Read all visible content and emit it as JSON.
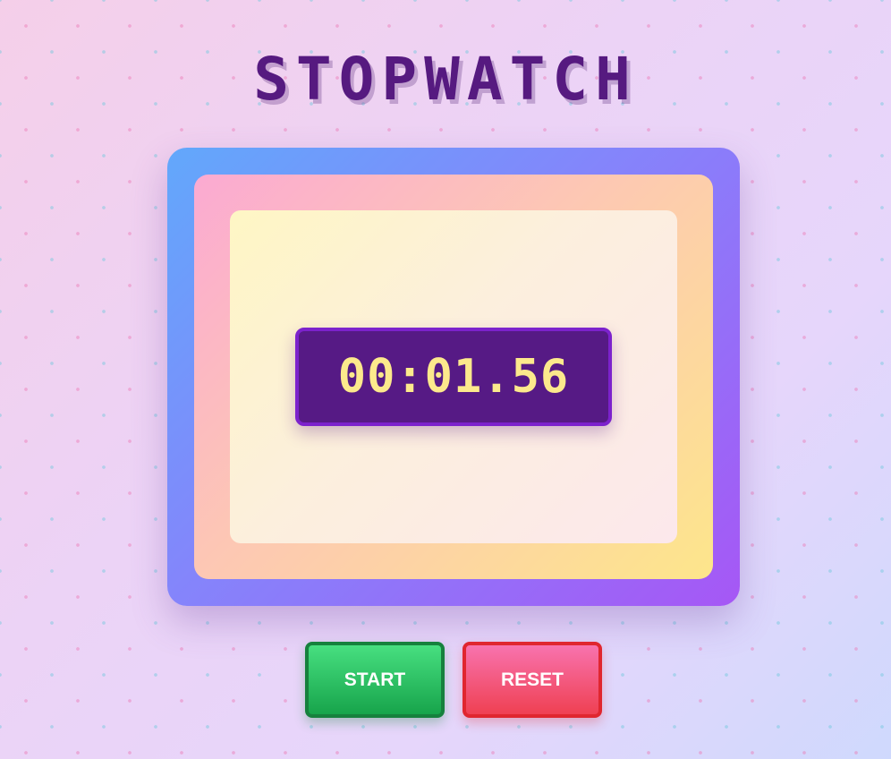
{
  "app": {
    "title": "STOPWATCH"
  },
  "display": {
    "time": "00:01.56"
  },
  "controls": {
    "start_label": "START",
    "reset_label": "RESET"
  },
  "colors": {
    "title": "#561a80",
    "display_background": "#561a85",
    "display_text": "#fce98c",
    "start_button": "#22c55e",
    "reset_button": "#ef4444"
  }
}
